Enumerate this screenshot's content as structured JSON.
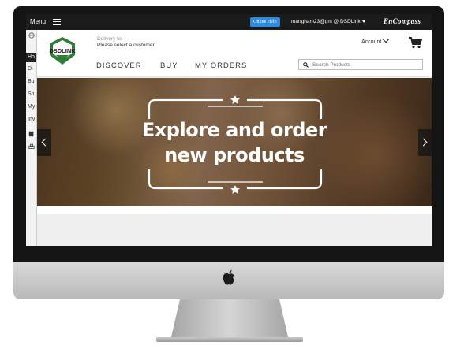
{
  "topbar": {
    "menu_label": "Menu",
    "online_help": "Online Help",
    "user": "mangham23@gm @ DSDLink",
    "brand": "EnCompass"
  },
  "sidenav": {
    "items": [
      "Ho",
      "Di",
      "Bu",
      "Sh",
      "My",
      "Inv"
    ]
  },
  "header": {
    "logo_text": "DSDLINK",
    "delivery_label": "Delivery to",
    "delivery_value": "Please select a customer",
    "account_label": "Account",
    "nav": [
      "DISCOVER",
      "BUY",
      "MY ORDERS"
    ],
    "search_placeholder": "Search Products"
  },
  "hero": {
    "line1": "Explore and order",
    "line2": "new products"
  },
  "colors": {
    "online_help": "#2d8be0",
    "topbar": "#1b1b1b",
    "logo_green": "#2e7d32"
  }
}
